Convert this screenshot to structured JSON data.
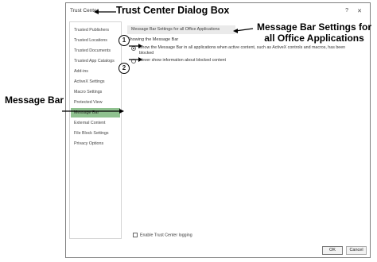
{
  "dialog": {
    "title": "Trust Center",
    "help_label": "?",
    "close_label": "✕",
    "ok_label": "OK",
    "cancel_label": "Cancel"
  },
  "sidebar": {
    "items": [
      {
        "label": "Trusted Publishers"
      },
      {
        "label": "Trusted Locations"
      },
      {
        "label": "Trusted Documents"
      },
      {
        "label": "Trusted App Catalogs"
      },
      {
        "label": "Add-ins"
      },
      {
        "label": "ActiveX Settings"
      },
      {
        "label": "Macro Settings"
      },
      {
        "label": "Protected View"
      },
      {
        "label": "Message Bar"
      },
      {
        "label": "External Content"
      },
      {
        "label": "File Block Settings"
      },
      {
        "label": "Privacy Options"
      }
    ],
    "selected_index": 8
  },
  "content": {
    "section_header": "Message Bar Settings for all Office Applications",
    "group_label": "Showing the Message Bar",
    "option1_line1": "Show the Message Bar in all applications when active content, such as ActiveX controls and macros, has been",
    "option1_line2": "blocked",
    "option2": "Never show information about blocked content",
    "selected_option": 1,
    "checkbox_label": "Enable Trust Center logging",
    "checkbox_checked": false
  },
  "annotations": {
    "trust_center": "Trust Center Dialog Box",
    "message_bar": "Message Bar",
    "settings_line1": "Message Bar Settings for",
    "settings_line2": "all Office Applications",
    "num1": "1",
    "num2": "2"
  },
  "colors": {
    "selected_item": "#8fc18f",
    "section_header_bg": "#eaeaea"
  }
}
